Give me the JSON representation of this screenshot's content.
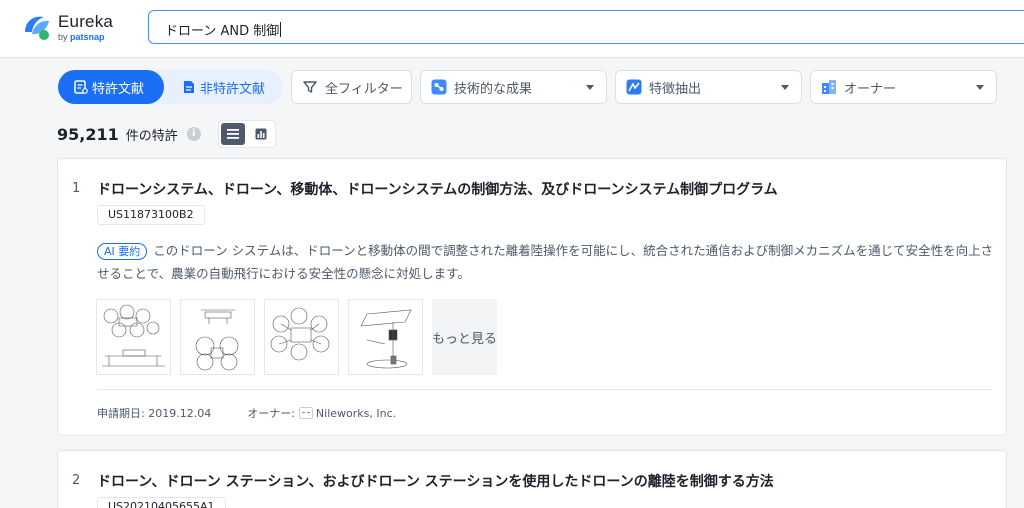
{
  "app": {
    "logo_title": "Eureka",
    "logo_sub_prefix": "by",
    "logo_sub_brand": "patsnap",
    "brand_color": "#1b6ff5"
  },
  "search": {
    "value": "ドローン AND 制御"
  },
  "tabs": {
    "patent_label": "特許文献",
    "nonpatent_label": "非特許文献"
  },
  "filters": {
    "all_filters": "全フィルター",
    "tech_results": "技術的な成果",
    "feature_extract": "特徴抽出",
    "owner": "オーナー"
  },
  "results": {
    "count": "95,211",
    "unit": "件の特許"
  },
  "items": [
    {
      "rank": "1",
      "title": "ドローンシステム、ドローン、移動体、ドローンシステムの制御方法、及びドローンシステム制御プログラム",
      "number": "US11873100B2",
      "ai_tag": "AI 要約",
      "summary": "このドローン システムは、ドローンと移動体の間で調整された離着陸操作を可能にし、統合された通信および制御メカニズムを通じて安全性を向上させることで、農業の自動飛行における安全性の懸念に対処します。",
      "more_label": "もっと見る",
      "date_label": "申請期日:",
      "date": "2019.12.04",
      "owner_label": "オーナー:",
      "owner": "Nileworks, Inc."
    },
    {
      "rank": "2",
      "title": "ドローン、ドローン ステーション、およびドローン ステーションを使用したドローンの離陸を制御する方法",
      "number": "US20210405655A1"
    }
  ]
}
